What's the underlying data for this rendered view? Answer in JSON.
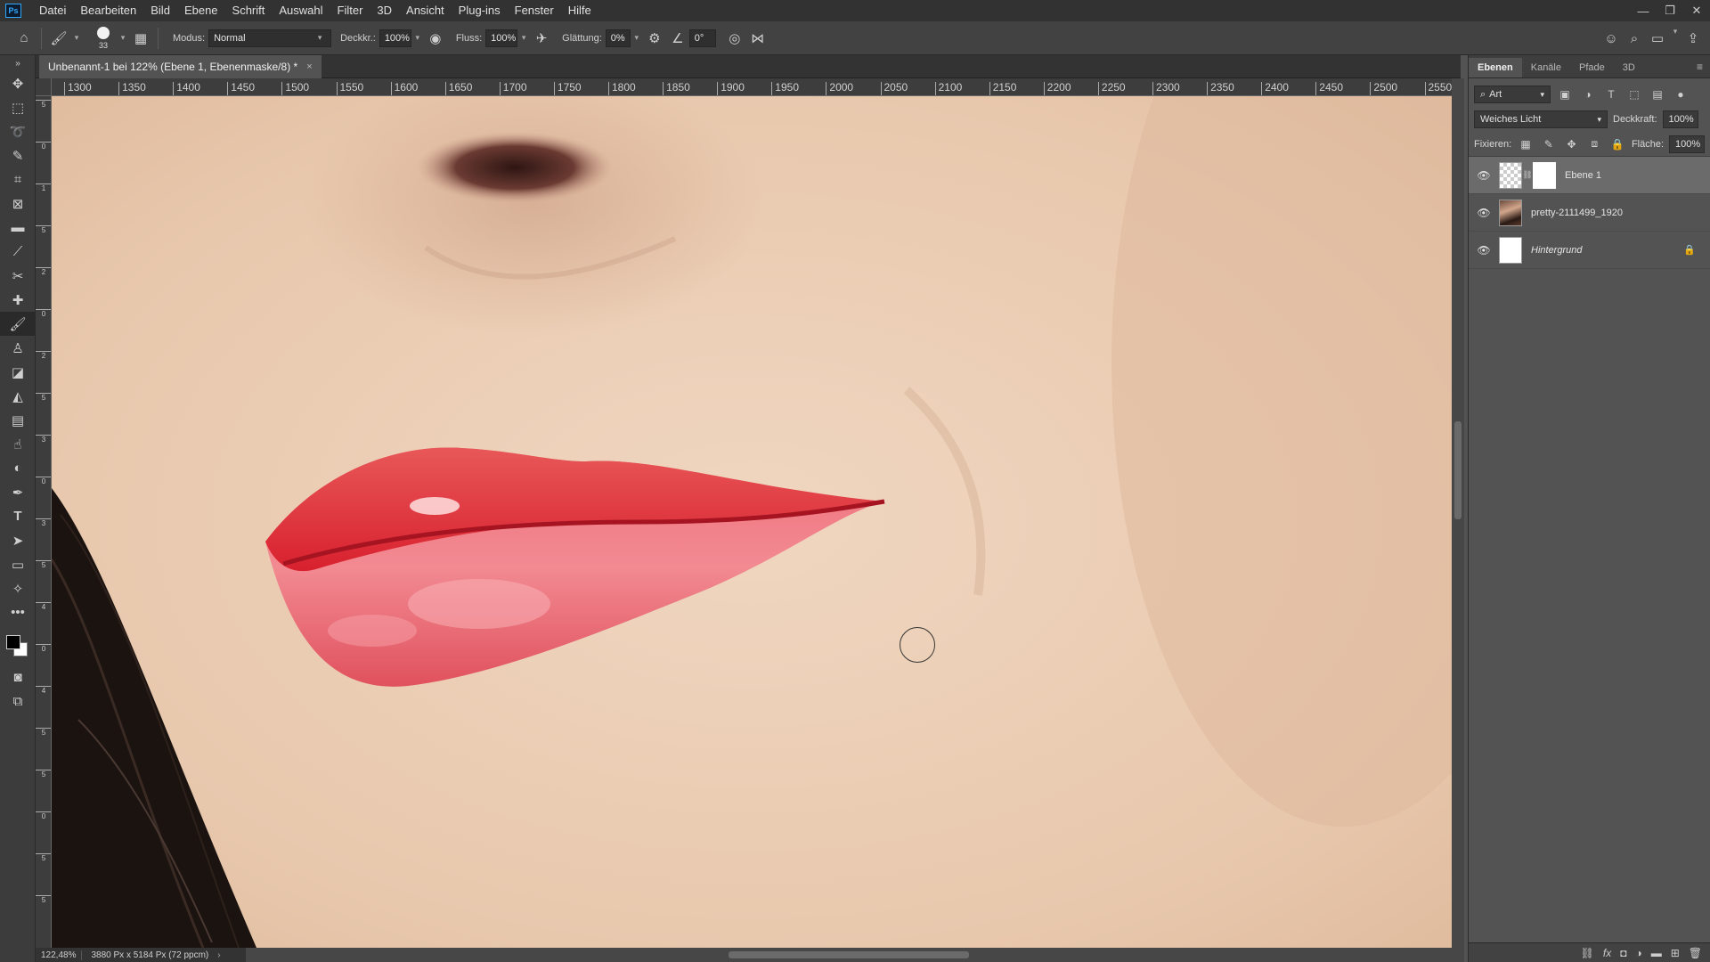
{
  "menubar": {
    "app_logo": "Ps",
    "items": [
      "Datei",
      "Bearbeiten",
      "Bild",
      "Ebene",
      "Schrift",
      "Auswahl",
      "Filter",
      "3D",
      "Ansicht",
      "Plug-ins",
      "Fenster",
      "Hilfe"
    ],
    "window_controls": [
      "minimize-icon",
      "restore-icon",
      "close-icon"
    ]
  },
  "options": {
    "brush_size": "33",
    "mode_label": "Modus:",
    "mode_value": "Normal",
    "opacity_label": "Deckkr.:",
    "opacity_value": "100%",
    "flow_label": "Fluss:",
    "flow_value": "100%",
    "smoothing_label": "Glättung:",
    "smoothing_value": "0%",
    "angle_value": "0°"
  },
  "document": {
    "tab_title": "Unbenannt-1 bei 122% (Ebene 1, Ebenenmaske/8) *",
    "close_glyph": "×"
  },
  "ruler": {
    "top_labels": [
      "1300",
      "1350",
      "1400",
      "1450",
      "1500",
      "1550",
      "1600",
      "1650",
      "1700",
      "1750",
      "1800",
      "1850",
      "1900",
      "1950",
      "2000",
      "2050",
      "2100",
      "2150",
      "2200",
      "2250",
      "2300",
      "2350",
      "2400",
      "2450",
      "2500",
      "2550"
    ],
    "left_labels": [
      "5",
      "0",
      "1",
      "5",
      "2",
      "0",
      "2",
      "5",
      "3",
      "0",
      "3",
      "5",
      "4",
      "0",
      "4",
      "5",
      "5",
      "0",
      "5",
      "5"
    ]
  },
  "status": {
    "zoom": "122,48%",
    "doc_info": "3880 Px x 5184 Px (72 ppcm)",
    "arrow": "›"
  },
  "panel": {
    "tabs": [
      "Ebenen",
      "Kanäle",
      "Pfade",
      "3D"
    ],
    "filter_label": "Art",
    "blend_mode": "Weiches Licht",
    "opacity_label": "Deckkraft:",
    "opacity_value": "100%",
    "lock_label": "Fixieren:",
    "fill_label": "Fläche:",
    "fill_value": "100%",
    "layers": [
      {
        "name": "Ebene 1",
        "active": true
      },
      {
        "name": "pretty-2111499_1920",
        "active": false
      },
      {
        "name": "Hintergrund",
        "active": false,
        "locked": true
      }
    ]
  },
  "colors": {
    "foreground": "#000000",
    "background": "#ffffff",
    "accent": "#31a8ff"
  }
}
